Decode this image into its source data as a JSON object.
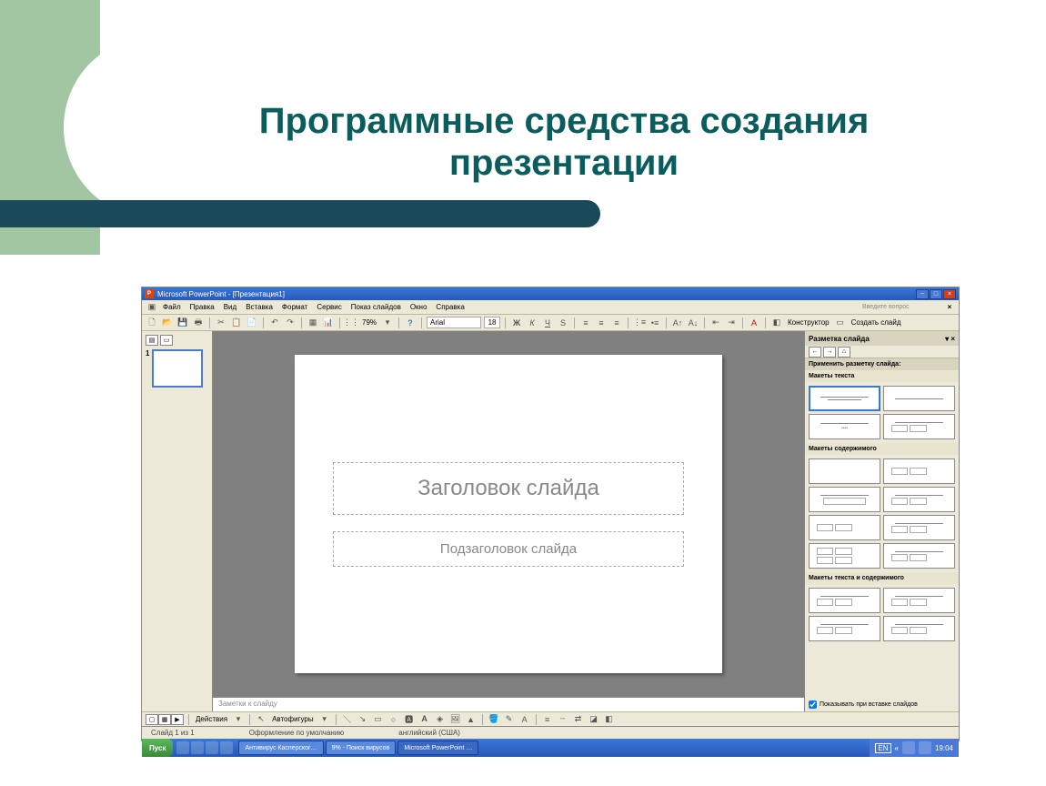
{
  "presentation": {
    "title": "Программные средства создания презентации"
  },
  "screenshot": {
    "window_title": "Microsoft PowerPoint - [Презентация1]",
    "help_placeholder": "Введите вопрос",
    "menus": [
      "Файл",
      "Правка",
      "Вид",
      "Вставка",
      "Формат",
      "Сервис",
      "Показ слайдов",
      "Окно",
      "Справка"
    ],
    "toolbar": {
      "zoom": "79%",
      "font_name": "Arial",
      "font_size": "18",
      "constructor_label": "Конструктор",
      "new_slide_label": "Создать слайд"
    },
    "thumbs": {
      "current": "1"
    },
    "slide": {
      "title_placeholder": "Заголовок слайда",
      "subtitle_placeholder": "Подзаголовок слайда"
    },
    "notes_placeholder": "Заметки к слайду",
    "taskpane": {
      "title": "Разметка слайда",
      "apply_label": "Применить разметку слайда:",
      "sections": {
        "text_layouts": "Макеты текста",
        "content_layouts": "Макеты содержимого",
        "text_content_layouts": "Макеты текста и содержимого"
      },
      "show_on_insert": "Показывать при вставке слайдов"
    },
    "bottombar": {
      "actions": "Действия",
      "autoshapes": "Автофигуры"
    },
    "statusbar": {
      "slide_info": "Слайд 1 из 1",
      "design": "Оформление по умолчанию",
      "language": "английский (США)"
    },
    "taskbar": {
      "start": "Пуск",
      "tasks": [
        "Антивирус Касперског…",
        "9% - Поиск вирусов",
        "Microsoft PowerPoint …"
      ],
      "lang": "EN",
      "time": "19:04"
    }
  }
}
